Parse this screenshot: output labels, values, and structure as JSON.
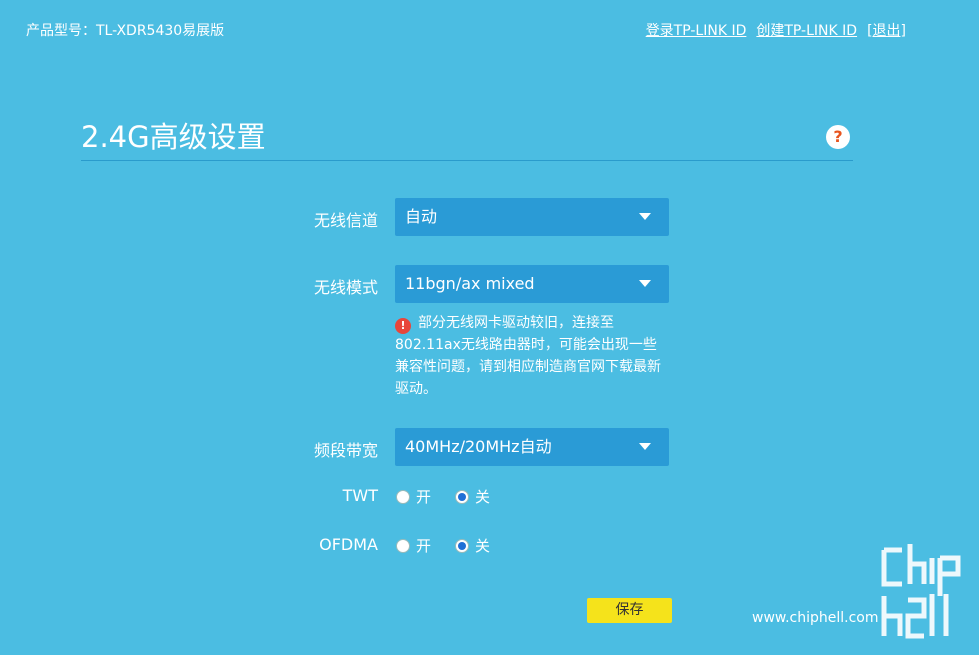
{
  "header": {
    "product": "产品型号：TL-XDR5430易展版",
    "links": [
      "登录TP-LINK ID",
      "创建TP-LINK ID",
      "[退出]"
    ]
  },
  "page": {
    "title": "2.4G高级设置",
    "help": "?"
  },
  "fields": {
    "channel": {
      "label": "无线信道",
      "value": "自动"
    },
    "mode": {
      "label": "无线模式",
      "value": "11bgn/ax mixed"
    },
    "warning": {
      "icon": "!",
      "text": "部分无线网卡驱动较旧，连接至802.11ax无线路由器时，可能会出现一些兼容性问题，请到相应制造商官网下载最新驱动。"
    },
    "bandwidth": {
      "label": "频段带宽",
      "value": "40MHz/20MHz自动"
    },
    "twt": {
      "label": "TWT",
      "on": "开",
      "off": "关",
      "selected": "off"
    },
    "ofdma": {
      "label": "OFDMA",
      "on": "开",
      "off": "关",
      "selected": "off"
    }
  },
  "actions": {
    "save": "保存"
  },
  "watermark": {
    "url": "www.chiphell.com"
  },
  "colors": {
    "background": "#4bbde2",
    "select": "#2a9bd6",
    "save": "#f5e31b",
    "warning": "#e8463b"
  }
}
